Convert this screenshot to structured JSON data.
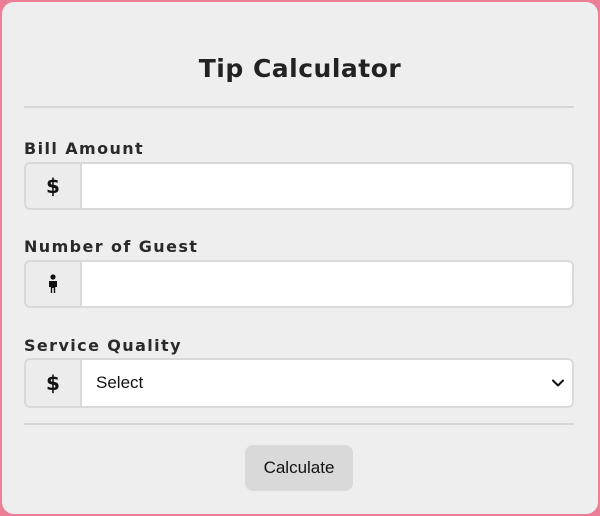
{
  "title": "Tip Calculator",
  "fields": {
    "bill": {
      "label": "Bill Amount",
      "addon": "$",
      "value": "",
      "placeholder": ""
    },
    "guests": {
      "label": "Number of Guest",
      "addon_icon": "person-icon",
      "value": "",
      "placeholder": ""
    },
    "service": {
      "label": "Service Quality",
      "addon": "$",
      "selected": "Select"
    }
  },
  "button": {
    "label": "Calculate"
  },
  "colors": {
    "page_background": "#ea7f97",
    "card_background": "#eeeeee",
    "button_background": "#d9d9d9"
  }
}
